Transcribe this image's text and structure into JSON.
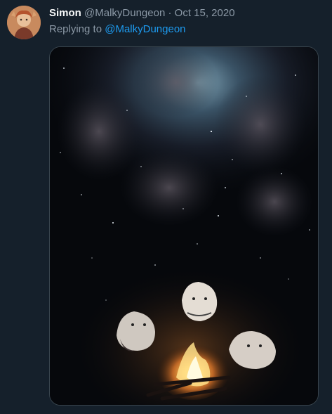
{
  "tweet": {
    "author_name": "Simon",
    "author_handle": "@MalkyDungeon",
    "separator": "·",
    "date": "Oct 15, 2020",
    "replying_to_label": "Replying to",
    "replying_to_handle": "@MalkyDungeon"
  },
  "media": {
    "description_icon": "image-icon",
    "accent_color": "#1d9bf0",
    "background_color": "#15202b"
  }
}
